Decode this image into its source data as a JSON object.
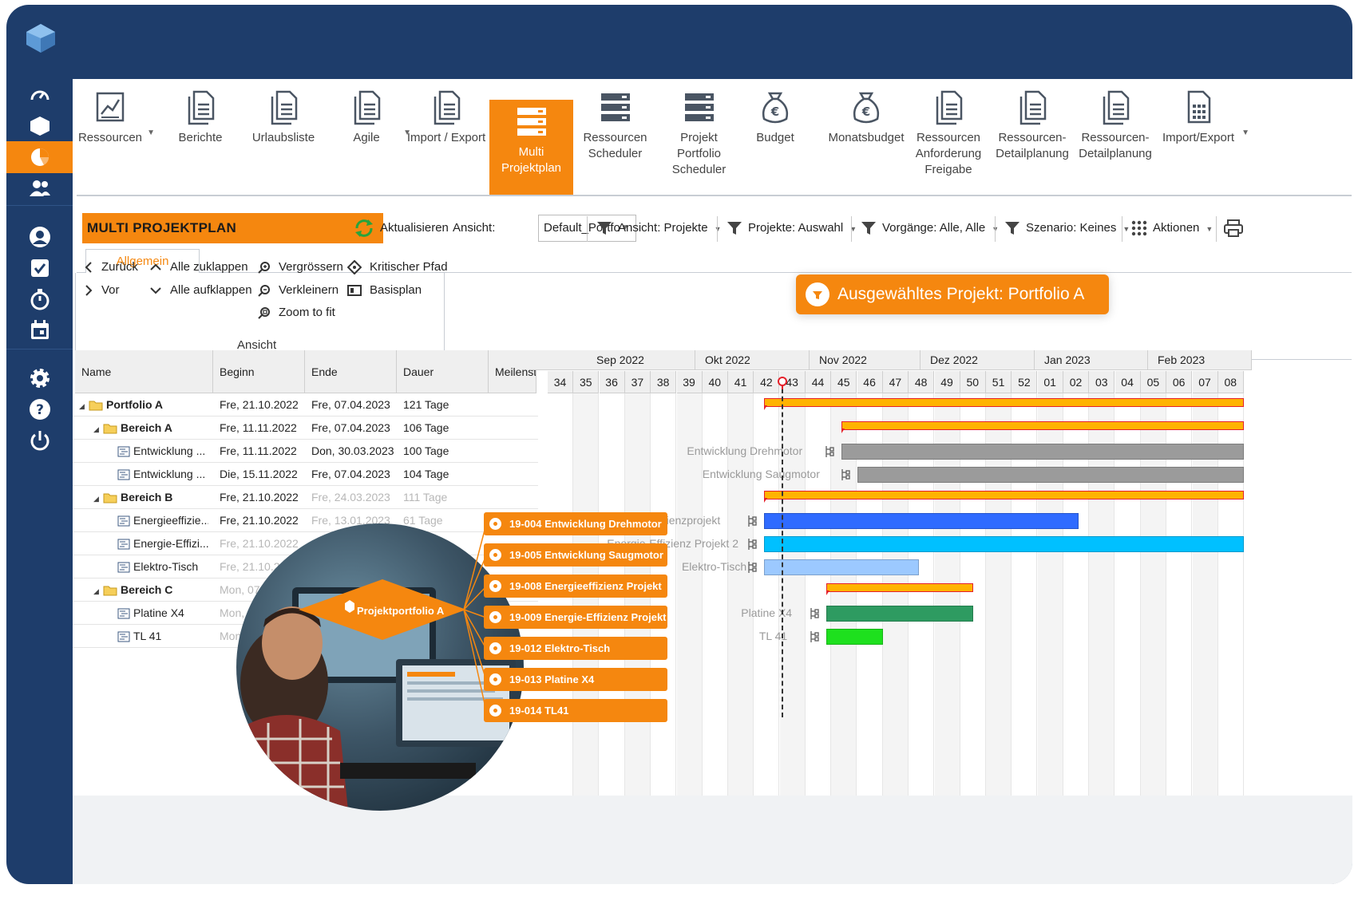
{
  "ribbon": [
    {
      "label": "Ressourcen",
      "icon": "chart-page-icon",
      "caret": true
    },
    {
      "label": "Berichte",
      "icon": "document-icon",
      "caret": false
    },
    {
      "label": "Urlaubsliste",
      "icon": "document-icon",
      "caret": false
    },
    {
      "label": "Agile",
      "icon": "document-icon",
      "caret": true
    },
    {
      "label": "Import / Export",
      "icon": "document-icon",
      "caret": false
    },
    {
      "label": "Multi Projektplan",
      "icon": "server-stack-icon",
      "caret": false,
      "active": true
    },
    {
      "label": "Ressourcen Scheduler",
      "icon": "server-stack-icon",
      "caret": false
    },
    {
      "label": "Projekt Portfolio Scheduler",
      "icon": "server-stack-icon",
      "caret": false
    },
    {
      "label": "Budget",
      "icon": "money-bag-icon",
      "caret": false
    },
    {
      "label": "Monatsbudget",
      "icon": "money-bag-icon",
      "caret": false
    },
    {
      "label": "Ressourcen Anforderung Freigabe",
      "icon": "document-icon",
      "caret": false
    },
    {
      "label": "Ressourcen-Detailplanung",
      "icon": "document-icon",
      "caret": false
    },
    {
      "label": "Ressourcen-Detailplanung",
      "icon": "document-icon",
      "caret": false
    },
    {
      "label": "Import/Export",
      "icon": "calculator-page-icon",
      "caret": true
    }
  ],
  "toolbar": {
    "title": "MULTI PROJEKTPLAN",
    "refresh": "Aktualisieren",
    "view_label": "Ansicht:",
    "view_value": "Default_Portfo",
    "filter_view": "Ansicht: Projekte",
    "filter_projects": "Projekte: Auswahl",
    "filter_tasks": "Vorgänge: Alle, Alle",
    "filter_scenario": "Szenario: Keines",
    "actions": "Aktionen"
  },
  "tabs": {
    "general": "Allgemein"
  },
  "group": {
    "back": "Zurück",
    "forward": "Vor",
    "collapse_all": "Alle zuklappen",
    "expand_all": "Alle aufklappen",
    "zoom_in": "Vergrössern",
    "zoom_out": "Verkleinern",
    "zoom_fit": "Zoom to fit",
    "critical_path": "Kritischer Pfad",
    "baseline": "Basisplan",
    "label": "Ansicht"
  },
  "badge": "Ausgewähltes Projekt: Portfolio A",
  "columns": {
    "name": "Name",
    "begin": "Beginn",
    "end": "Ende",
    "duration": "Dauer",
    "milestone": "Meilenste"
  },
  "rows": [
    {
      "name": "Portfolio A",
      "begin": "Fre, 21.10.2022",
      "end": "Fre, 07.04.2023",
      "duration": "121 Tage"
    },
    {
      "name": "Bereich A",
      "begin": "Fre, 11.11.2022",
      "end": "Fre, 07.04.2023",
      "duration": "106 Tage"
    },
    {
      "name": "Entwicklung ...",
      "begin": "Fre, 11.11.2022",
      "end": "Don, 30.03.2023",
      "duration": "100 Tage"
    },
    {
      "name": "Entwicklung ...",
      "begin": "Die, 15.11.2022",
      "end": "Fre, 07.04.2023",
      "duration": "104 Tage"
    },
    {
      "name": "Bereich B",
      "begin": "Fre, 21.10.2022",
      "end": "Fre, 24.03.2023",
      "duration": "111 Tage"
    },
    {
      "name": "Energieeffizie...",
      "begin": "Fre, 21.10.2022",
      "end": "Fre, 13.01.2023",
      "duration": "61 Tage"
    },
    {
      "name": "Energie-Effizi...",
      "begin": "Fre, 21.10.2022",
      "end": "",
      "duration": ""
    },
    {
      "name": "Elektro-Tisch",
      "begin": "Fre, 21.10.20",
      "end": "",
      "duration": ""
    },
    {
      "name": "Bereich C",
      "begin": "Mon, 07.1",
      "end": "",
      "duration": ""
    },
    {
      "name": "Platine X4",
      "begin": "Mon, 0",
      "end": "",
      "duration": ""
    },
    {
      "name": "TL 41",
      "begin": "Mon",
      "end": "",
      "duration": ""
    }
  ],
  "months": [
    "Sep 2022",
    "Okt 2022",
    "Nov 2022",
    "Dez 2022",
    "Jan 2023",
    "Feb 2023"
  ],
  "weeks": [
    "34",
    "35",
    "36",
    "37",
    "38",
    "39",
    "40",
    "41",
    "42",
    "43",
    "44",
    "45",
    "46",
    "47",
    "48",
    "49",
    "50",
    "51",
    "52",
    "01",
    "02",
    "03",
    "04",
    "05",
    "06",
    "07",
    "08"
  ],
  "gantt_labels": {
    "drehmotor": "Entwicklung Drehmotor",
    "saugmotor": "Entwicklung Saugmotor",
    "energie1": "ienzprojekt",
    "energie2": "Energie-Effizienz Projekt 2",
    "elektro": "Elektro-Tisch",
    "platine": "Platine X4",
    "tl41": "TL 41"
  },
  "callouts": [
    "19-004 Entwicklung Drehmotor",
    "19-005 Entwicklung Saugmotor",
    "19-008 Energieeffizienz Projekt",
    "19-009 Energie-Effizienz Projekt 2",
    "19-012 Elektro-Tisch",
    "19-013 Platine X4",
    "19-014 TL41"
  ],
  "diamond_label": "Projektportfolio A",
  "colors": {
    "accent": "#f5870f",
    "navy": "#1e3d6b",
    "summary": "#ffb300",
    "critical": "#e5202a",
    "gray_bar": "#9b9b9b",
    "blue_bar": "#2f6bff",
    "cyan_bar": "#00c0ff",
    "light_blue_bar": "#9cc9ff",
    "green_dark": "#2e9b61",
    "green_bright": "#1ee01e"
  }
}
